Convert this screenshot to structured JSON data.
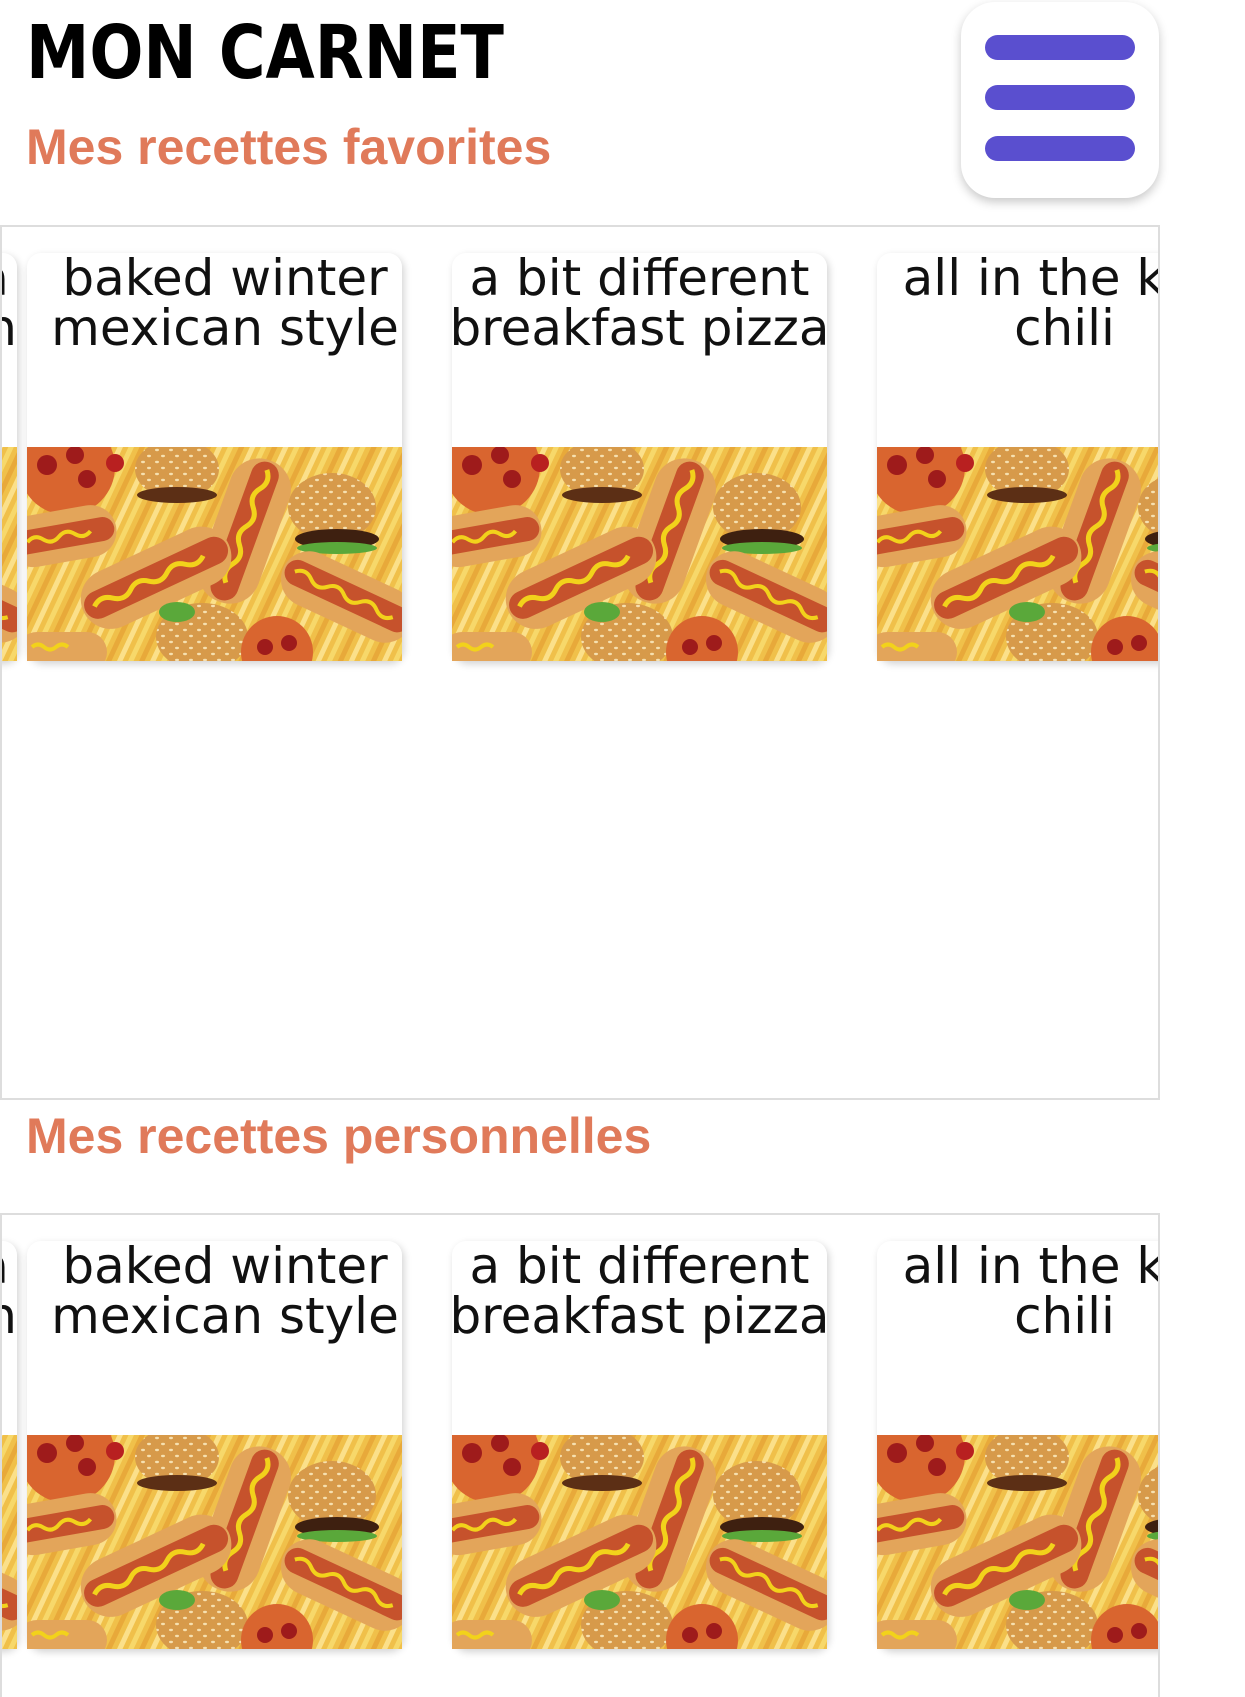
{
  "header": {
    "app_title": "MON CARNET",
    "menu_icon": "hamburger-menu-icon",
    "menu_color": "#5a4fcf"
  },
  "favorites": {
    "title": "Mes recettes favorites",
    "cards": [
      {
        "title_line1": "rriba",
        "title_line2": "quash",
        "image": "fast-food-image"
      },
      {
        "title_line1": "baked winter",
        "title_line2": "mexican style",
        "image": "fast-food-image"
      },
      {
        "title_line1": "a bit different",
        "title_line2": "breakfast pizza",
        "image": "fast-food-image"
      },
      {
        "title_line1": "all in the kitc",
        "title_line2": "chili",
        "image": "fast-food-image"
      }
    ]
  },
  "personal": {
    "title": "Mes recettes personnelles",
    "cards": [
      {
        "title_line1": "rriba",
        "title_line2": "quash",
        "image": "fast-food-image"
      },
      {
        "title_line1": "baked winter",
        "title_line2": "mexican style",
        "image": "fast-food-image"
      },
      {
        "title_line1": "a bit different",
        "title_line2": "breakfast pizza",
        "image": "fast-food-image"
      },
      {
        "title_line1": "all in the kitc",
        "title_line2": "chili",
        "image": "fast-food-image"
      }
    ]
  },
  "colors": {
    "section_title": "#e07a5a",
    "carousel_border": "#dddddd"
  }
}
